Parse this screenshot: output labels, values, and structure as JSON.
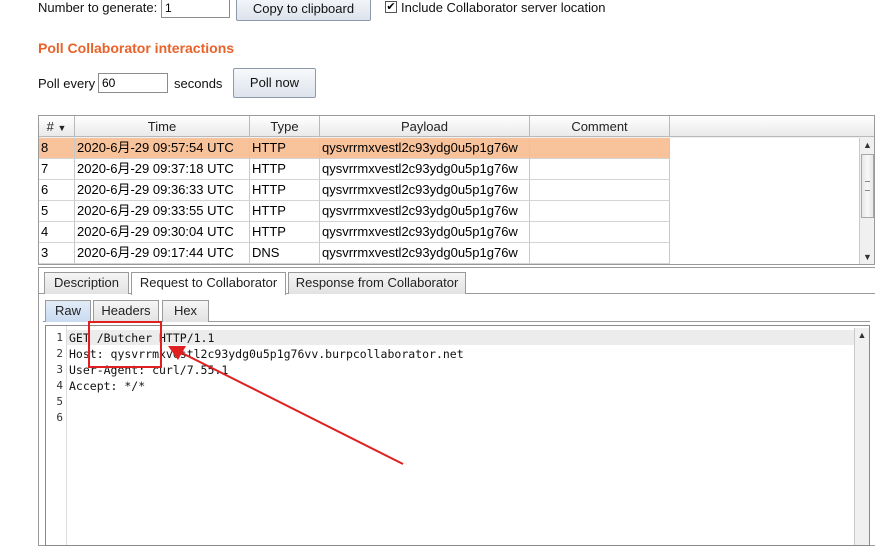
{
  "generate": {
    "label": "Number to generate:",
    "value": "1",
    "copy_button": "Copy to clipboard",
    "include_label": "Include Collaborator server location",
    "include_checked": true
  },
  "poll": {
    "title": "Poll Collaborator interactions",
    "every_label": "Poll every",
    "interval": "60",
    "seconds_label": "seconds",
    "poll_button": "Poll now"
  },
  "table": {
    "columns": [
      "#",
      "Time",
      "Type",
      "Payload",
      "Comment"
    ],
    "sort_indicator": "▼",
    "rows": [
      {
        "num": "8",
        "time": "2020-6月-29 09:57:54 UTC",
        "type": "HTTP",
        "payload": "qysvrrmxvestl2c93ydg0u5p1g76w",
        "comment": "",
        "selected": true
      },
      {
        "num": "7",
        "time": "2020-6月-29 09:37:18 UTC",
        "type": "HTTP",
        "payload": "qysvrrmxvestl2c93ydg0u5p1g76w",
        "comment": ""
      },
      {
        "num": "6",
        "time": "2020-6月-29 09:36:33 UTC",
        "type": "HTTP",
        "payload": "qysvrrmxvestl2c93ydg0u5p1g76w",
        "comment": ""
      },
      {
        "num": "5",
        "time": "2020-6月-29 09:33:55 UTC",
        "type": "HTTP",
        "payload": "qysvrrmxvestl2c93ydg0u5p1g76w",
        "comment": ""
      },
      {
        "num": "4",
        "time": "2020-6月-29 09:30:04 UTC",
        "type": "HTTP",
        "payload": "qysvrrmxvestl2c93ydg0u5p1g76w",
        "comment": ""
      },
      {
        "num": "3",
        "time": "2020-6月-29 09:17:44 UTC",
        "type": "DNS",
        "payload": "qysvrrmxvestl2c93ydg0u5p1g76w",
        "comment": ""
      }
    ]
  },
  "detail_tabs": [
    "Description",
    "Request to Collaborator",
    "Response from Collaborator"
  ],
  "view_tabs": [
    "Raw",
    "Headers",
    "Hex"
  ],
  "editor": {
    "lines": [
      "GET /Butcher HTTP/1.1",
      "Host: qysvrrmxvestl2c93ydg0u5p1g76vv.burpcollaborator.net",
      "User-Agent: curl/7.55.1",
      "Accept: */*",
      "",
      ""
    ],
    "line_numbers": [
      "1",
      "2",
      "3",
      "4",
      "5",
      "6"
    ]
  },
  "colors": {
    "accent": "#e8622a",
    "selected_row": "#f8c29a",
    "annotation": "#e02020"
  }
}
